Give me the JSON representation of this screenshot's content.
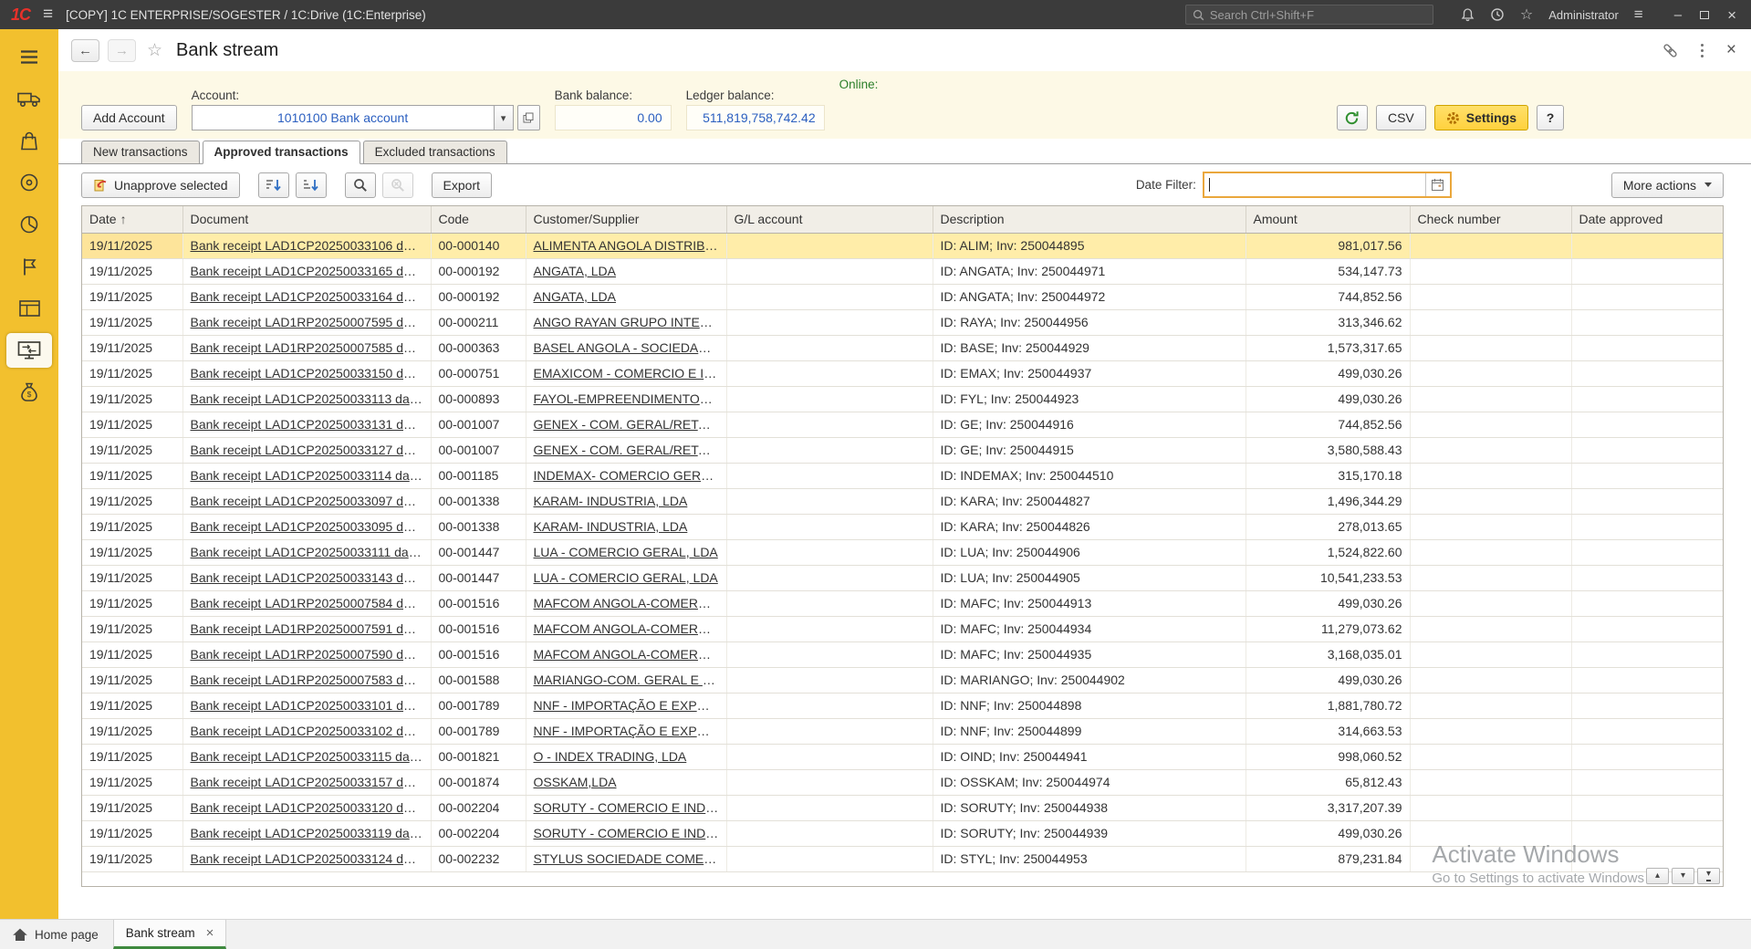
{
  "topbar": {
    "logo": "1C",
    "title": "[COPY] 1C ENTERPRISE/SOGESTER / 1C:Drive  (1C:Enterprise)",
    "search_placeholder": "Search Ctrl+Shift+F",
    "user": "Administrator"
  },
  "icons": {
    "menu": "≡",
    "back": "←",
    "forward": "→",
    "star": "☆",
    "close": "×",
    "minimize": "–",
    "up": "▴",
    "down": "▾"
  },
  "window": {
    "title": "Bank stream"
  },
  "panel": {
    "add_account_label": "Add Account",
    "account_label": "Account:",
    "account_value": "1010100 Bank account",
    "bank_balance_label": "Bank balance:",
    "bank_balance_value": "0.00",
    "ledger_balance_label": "Ledger balance:",
    "ledger_balance_value": "511,819,758,742.42",
    "online_label": "Online:",
    "csv_label": "CSV",
    "settings_label": "Settings",
    "help_label": "?"
  },
  "tabs": [
    {
      "label": "New transactions",
      "active": false
    },
    {
      "label": "Approved transactions",
      "active": true
    },
    {
      "label": "Excluded transactions",
      "active": false
    }
  ],
  "toolbar": {
    "unapprove_label": "Unapprove selected",
    "export_label": "Export",
    "date_filter_label": "Date Filter:",
    "more_actions_label": "More actions"
  },
  "table": {
    "columns": [
      "Date",
      "Document",
      "Code",
      "Customer/Supplier",
      "G/L account",
      "Description",
      "Amount",
      "Check number",
      "Date approved"
    ],
    "sorted_column": 0,
    "sort_arrow": "↑",
    "selected_index": 0,
    "rows": [
      {
        "date": "19/11/2025",
        "document": "Bank receipt LAD1CP20250033106 dated...",
        "code": "00-000140",
        "customer": "ALIMENTA ANGOLA DISTRIBUI...",
        "gl_account": "",
        "description": "ID: ALIM; Inv: 250044895",
        "amount": "981,017.56",
        "check_number": "",
        "date_approved": ""
      },
      {
        "date": "19/11/2025",
        "document": "Bank receipt LAD1CP20250033165 dated...",
        "code": "00-000192",
        "customer": "ANGATA, LDA",
        "gl_account": "",
        "description": "ID: ANGATA; Inv: 250044971",
        "amount": "534,147.73",
        "check_number": "",
        "date_approved": ""
      },
      {
        "date": "19/11/2025",
        "document": "Bank receipt LAD1CP20250033164 dated...",
        "code": "00-000192",
        "customer": "ANGATA, LDA",
        "gl_account": "",
        "description": "ID: ANGATA; Inv: 250044972",
        "amount": "744,852.56",
        "check_number": "",
        "date_approved": ""
      },
      {
        "date": "19/11/2025",
        "document": "Bank receipt LAD1RP20250007595 dated...",
        "code": "00-000211",
        "customer": "ANGO RAYAN GRUPO INTERN...",
        "gl_account": "",
        "description": "ID: RAYA; Inv: 250044956",
        "amount": "313,346.62",
        "check_number": "",
        "date_approved": ""
      },
      {
        "date": "19/11/2025",
        "document": "Bank receipt LAD1RP20250007585 dated...",
        "code": "00-000363",
        "customer": "BASEL ANGOLA - SOCIEDADE ...",
        "gl_account": "",
        "description": "ID: BASE; Inv: 250044929",
        "amount": "1,573,317.65",
        "check_number": "",
        "date_approved": ""
      },
      {
        "date": "19/11/2025",
        "document": "Bank receipt LAD1CP20250033150 dated...",
        "code": "00-000751",
        "customer": "EMAXICOM - COMERCIO E IND...",
        "gl_account": "",
        "description": "ID: EMAX; Inv: 250044937",
        "amount": "499,030.26",
        "check_number": "",
        "date_approved": ""
      },
      {
        "date": "19/11/2025",
        "document": "Bank receipt LAD1CP20250033113 dated...",
        "code": "00-000893",
        "customer": "FAYOL-EMPREENDIMENTOS, ...",
        "gl_account": "",
        "description": "ID: FYL; Inv: 250044923",
        "amount": "499,030.26",
        "check_number": "",
        "date_approved": ""
      },
      {
        "date": "19/11/2025",
        "document": "Bank receipt LAD1CP20250033131 dated...",
        "code": "00-001007",
        "customer": "GENEX - COM. GERAL/RETALH...",
        "gl_account": "",
        "description": "ID: GE; Inv: 250044916",
        "amount": "744,852.56",
        "check_number": "",
        "date_approved": ""
      },
      {
        "date": "19/11/2025",
        "document": "Bank receipt LAD1CP20250033127 dated...",
        "code": "00-001007",
        "customer": "GENEX - COM. GERAL/RETALH...",
        "gl_account": "",
        "description": "ID: GE; Inv: 250044915",
        "amount": "3,580,588.43",
        "check_number": "",
        "date_approved": ""
      },
      {
        "date": "19/11/2025",
        "document": "Bank receipt LAD1CP20250033114 dated...",
        "code": "00-001185",
        "customer": "INDEMAX- COMERCIO GERAL ...",
        "gl_account": "",
        "description": "ID: INDEMAX; Inv: 250044510",
        "amount": "315,170.18",
        "check_number": "",
        "date_approved": ""
      },
      {
        "date": "19/11/2025",
        "document": "Bank receipt LAD1CP20250033097 dated...",
        "code": "00-001338",
        "customer": "KARAM- INDUSTRIA, LDA",
        "gl_account": "",
        "description": "ID: KARA; Inv: 250044827",
        "amount": "1,496,344.29",
        "check_number": "",
        "date_approved": ""
      },
      {
        "date": "19/11/2025",
        "document": "Bank receipt LAD1CP20250033095 dated...",
        "code": "00-001338",
        "customer": "KARAM- INDUSTRIA, LDA",
        "gl_account": "",
        "description": "ID: KARA; Inv: 250044826",
        "amount": "278,013.65",
        "check_number": "",
        "date_approved": ""
      },
      {
        "date": "19/11/2025",
        "document": "Bank receipt LAD1CP20250033111 dated...",
        "code": "00-001447",
        "customer": "LUA - COMERCIO GERAL, LDA",
        "gl_account": "",
        "description": "ID: LUA; Inv: 250044906",
        "amount": "1,524,822.60",
        "check_number": "",
        "date_approved": ""
      },
      {
        "date": "19/11/2025",
        "document": "Bank receipt LAD1CP20250033143 dated...",
        "code": "00-001447",
        "customer": "LUA - COMERCIO GERAL, LDA",
        "gl_account": "",
        "description": "ID: LUA; Inv: 250044905",
        "amount": "10,541,233.53",
        "check_number": "",
        "date_approved": ""
      },
      {
        "date": "19/11/2025",
        "document": "Bank receipt LAD1RP20250007584 dated...",
        "code": "00-001516",
        "customer": "MAFCOM ANGOLA-COMERCIO...",
        "gl_account": "",
        "description": "ID: MAFC; Inv: 250044913",
        "amount": "499,030.26",
        "check_number": "",
        "date_approved": ""
      },
      {
        "date": "19/11/2025",
        "document": "Bank receipt LAD1RP20250007591 dated...",
        "code": "00-001516",
        "customer": "MAFCOM ANGOLA-COMERCIO...",
        "gl_account": "",
        "description": "ID: MAFC; Inv: 250044934",
        "amount": "11,279,073.62",
        "check_number": "",
        "date_approved": ""
      },
      {
        "date": "19/11/2025",
        "document": "Bank receipt LAD1RP20250007590 dated...",
        "code": "00-001516",
        "customer": "MAFCOM ANGOLA-COMERCIO...",
        "gl_account": "",
        "description": "ID: MAFC; Inv: 250044935",
        "amount": "3,168,035.01",
        "check_number": "",
        "date_approved": ""
      },
      {
        "date": "19/11/2025",
        "document": "Bank receipt LAD1RP20250007583 dated...",
        "code": "00-001588",
        "customer": "MARIANGO-COM. GERAL E IN...",
        "gl_account": "",
        "description": "ID: MARIANGO; Inv: 250044902",
        "amount": "499,030.26",
        "check_number": "",
        "date_approved": ""
      },
      {
        "date": "19/11/2025",
        "document": "Bank receipt LAD1CP20250033101 dated...",
        "code": "00-001789",
        "customer": "NNF - IMPORTAÇÃO E EXPORT...",
        "gl_account": "",
        "description": "ID: NNF; Inv: 250044898",
        "amount": "1,881,780.72",
        "check_number": "",
        "date_approved": ""
      },
      {
        "date": "19/11/2025",
        "document": "Bank receipt LAD1CP20250033102 dated...",
        "code": "00-001789",
        "customer": "NNF - IMPORTAÇÃO E EXPORT...",
        "gl_account": "",
        "description": "ID: NNF; Inv: 250044899",
        "amount": "314,663.53",
        "check_number": "",
        "date_approved": ""
      },
      {
        "date": "19/11/2025",
        "document": "Bank receipt LAD1CP20250033115 dated...",
        "code": "00-001821",
        "customer": "O - INDEX TRADING, LDA",
        "gl_account": "",
        "description": "ID: OIND; Inv: 250044941",
        "amount": "998,060.52",
        "check_number": "",
        "date_approved": ""
      },
      {
        "date": "19/11/2025",
        "document": "Bank receipt LAD1CP20250033157 dated...",
        "code": "00-001874",
        "customer": "OSSKAM,LDA",
        "gl_account": "",
        "description": "ID: OSSKAM; Inv: 250044974",
        "amount": "65,812.43",
        "check_number": "",
        "date_approved": ""
      },
      {
        "date": "19/11/2025",
        "document": "Bank receipt LAD1CP20250033120 dated...",
        "code": "00-002204",
        "customer": "SORUTY - COMERCIO E INDUS...",
        "gl_account": "",
        "description": "ID: SORUTY; Inv: 250044938",
        "amount": "3,317,207.39",
        "check_number": "",
        "date_approved": ""
      },
      {
        "date": "19/11/2025",
        "document": "Bank receipt LAD1CP20250033119 dated...",
        "code": "00-002204",
        "customer": "SORUTY - COMERCIO E INDUS...",
        "gl_account": "",
        "description": "ID: SORUTY; Inv: 250044939",
        "amount": "499,030.26",
        "check_number": "",
        "date_approved": ""
      },
      {
        "date": "19/11/2025",
        "document": "Bank receipt LAD1CP20250033124 dated...",
        "code": "00-002232",
        "customer": "STYLUS SOCIEDADE COMERC...",
        "gl_account": "",
        "description": "ID: STYL; Inv: 250044953",
        "amount": "879,231.84",
        "check_number": "",
        "date_approved": ""
      }
    ]
  },
  "watermark": {
    "title": "Activate Windows",
    "subtitle": "Go to Settings to activate Windows"
  },
  "taskbar": {
    "home_label": "Home page",
    "tab_label": "Bank stream"
  }
}
